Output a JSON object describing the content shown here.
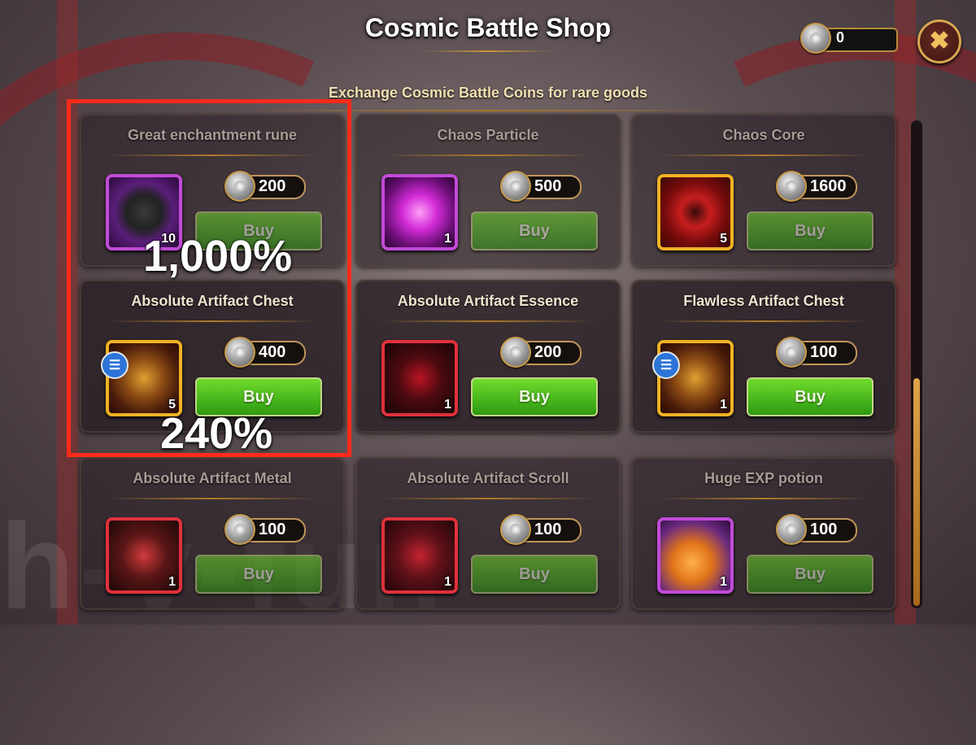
{
  "header": {
    "title": "Cosmic Battle Shop",
    "subtitle": "Exchange Cosmic Battle Coins for rare goods"
  },
  "currency": {
    "icon": "cosmic-coin-icon",
    "value": "0"
  },
  "close_icon": "close-icon",
  "watermark": "h-v-fun",
  "items": [
    {
      "name": "Great enchantment rune",
      "price": "200",
      "quantity": "10",
      "buy_label": "Buy",
      "frame": "purple",
      "icon": "enchantment-rune-icon"
    },
    {
      "name": "Chaos Particle",
      "price": "500",
      "quantity": "1",
      "buy_label": "Buy",
      "frame": "purple",
      "icon": "chaos-particle-icon"
    },
    {
      "name": "Chaos Core",
      "price": "1600",
      "quantity": "5",
      "buy_label": "Buy",
      "frame": "gold",
      "icon": "chaos-core-icon"
    },
    {
      "name": "Absolute Artifact Chest",
      "price": "400",
      "quantity": "5",
      "buy_label": "Buy",
      "frame": "gold",
      "icon": "artifact-chest-icon",
      "info_badge": true
    },
    {
      "name": "Absolute Artifact Essence",
      "price": "200",
      "quantity": "1",
      "buy_label": "Buy",
      "frame": "red",
      "icon": "artifact-essence-icon"
    },
    {
      "name": "Flawless Artifact Chest",
      "price": "100",
      "quantity": "1",
      "buy_label": "Buy",
      "frame": "gold",
      "icon": "artifact-chest-icon",
      "info_badge": true
    },
    {
      "name": "Absolute Artifact Metal",
      "price": "100",
      "quantity": "1",
      "buy_label": "Buy",
      "frame": "red",
      "icon": "artifact-metal-icon"
    },
    {
      "name": "Absolute Artifact Scroll",
      "price": "100",
      "quantity": "1",
      "buy_label": "Buy",
      "frame": "red",
      "icon": "artifact-scroll-icon"
    },
    {
      "name": "Huge EXP potion",
      "price": "100",
      "quantity": "1",
      "buy_label": "Buy",
      "frame": "purple",
      "icon": "exp-potion-icon"
    }
  ],
  "annotations": {
    "label_1": "1,000%",
    "label_2": "240%"
  },
  "colors": {
    "buy_green": "#3fb41a",
    "frame_purple": "#c24bd8",
    "frame_gold": "#f0b224",
    "frame_red": "#e0313b",
    "highlight_red": "#ff2a1a"
  }
}
